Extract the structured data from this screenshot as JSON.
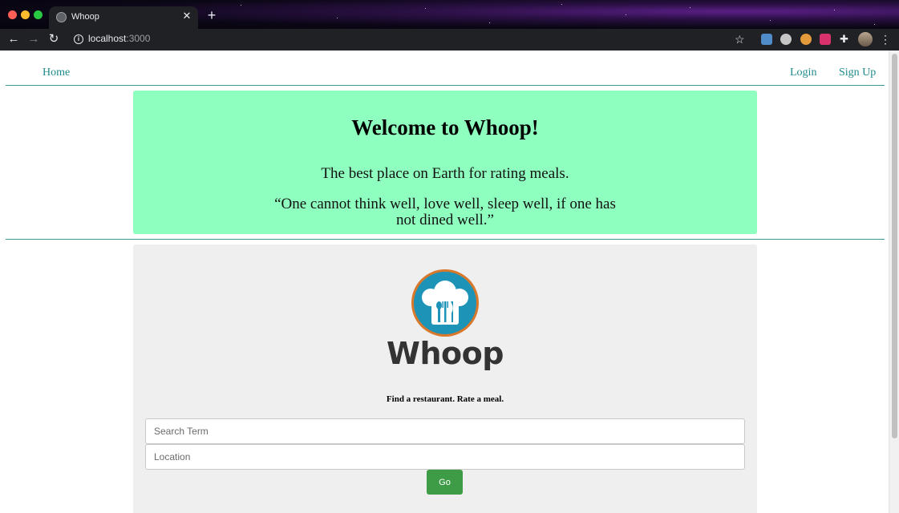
{
  "browser": {
    "tab_title": "Whoop",
    "url_host": "localhost",
    "url_port": ":3000"
  },
  "nav": {
    "home": "Home",
    "login": "Login",
    "signup": "Sign Up"
  },
  "hero": {
    "title": "Welcome to Whoop!",
    "tagline": "The best place on Earth for rating meals.",
    "quote": "“One cannot think well, love well, sleep well, if one has not dined well.”"
  },
  "search": {
    "logo_text": "Whoop",
    "subtitle": "Find a restaurant. Rate a meal.",
    "term_placeholder": "Search Term",
    "location_placeholder": "Location",
    "go_label": "Go"
  },
  "colors": {
    "hero_bg": "#8fffbf",
    "link": "#1f8a8a",
    "go_button": "#3d9c45",
    "logo_blue": "#1e93b8",
    "logo_ring": "#d9782a"
  }
}
